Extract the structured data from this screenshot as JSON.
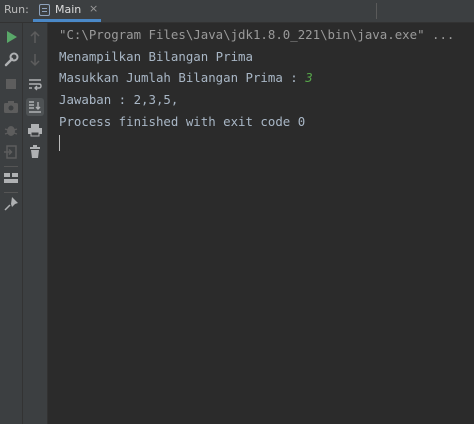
{
  "run_panel": {
    "label": "Run:",
    "tab": {
      "label": "Main",
      "close": "×"
    }
  },
  "icons": {
    "left_toolbar": [
      "run-icon",
      "wrench-icon",
      "stop-icon",
      "camera-icon",
      "bug-icon",
      "exit-icon",
      "layout-icon",
      "pin-icon"
    ],
    "right_toolbar": [
      "up-arrow-icon",
      "down-arrow-icon",
      "soft-wrap-icon",
      "scroll-to-end-icon",
      "print-icon",
      "trash-icon"
    ]
  },
  "console": {
    "command": "\"C:\\Program Files\\Java\\jdk1.8.0_221\\bin\\java.exe\" ...",
    "lines": [
      "Menampilkan Bilangan Prima",
      "Masukkan Jumlah Bilangan Prima : ",
      "Jawaban : 2,3,5,",
      "Process finished with exit code 0"
    ],
    "input_value": "3"
  },
  "colors": {
    "run_green": "#59a869",
    "user_input": "#57a64a",
    "console_text": "#a9b7c6",
    "tab_underline": "#4a88c7"
  }
}
